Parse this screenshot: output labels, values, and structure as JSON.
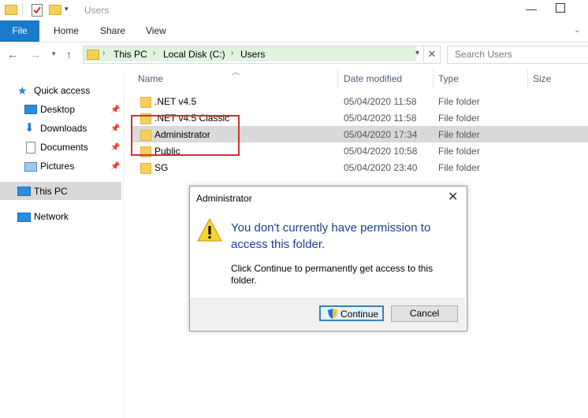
{
  "window": {
    "title": "Users"
  },
  "ribbon": {
    "file": "File",
    "tabs": [
      "Home",
      "Share",
      "View"
    ]
  },
  "address": {
    "crumbs": [
      "This PC",
      "Local Disk (C:)",
      "Users"
    ],
    "search_placeholder": "Search Users"
  },
  "sidebar": {
    "quick_access": "Quick access",
    "pinned": [
      "Desktop",
      "Downloads",
      "Documents",
      "Pictures"
    ],
    "this_pc": "This PC",
    "network": "Network"
  },
  "columns": {
    "name": "Name",
    "date": "Date modified",
    "type": "Type",
    "size": "Size"
  },
  "rows": [
    {
      "name": ".NET v4.5",
      "date": "05/04/2020 11:58",
      "type": "File folder"
    },
    {
      "name": ".NET v4.5 Classic",
      "date": "05/04/2020 11:58",
      "type": "File folder"
    },
    {
      "name": "Administrator",
      "date": "05/04/2020 17:34",
      "type": "File folder"
    },
    {
      "name": "Public",
      "date": "05/04/2020 10:58",
      "type": "File folder"
    },
    {
      "name": "SG",
      "date": "05/04/2020 23:40",
      "type": "File folder"
    }
  ],
  "dialog": {
    "title": "Administrator",
    "heading": "You don't currently have permission to access this folder.",
    "body": "Click Continue to permanently get access to this folder.",
    "continue": "Continue",
    "cancel": "Cancel"
  },
  "colors": {
    "accent": "#1979ca",
    "highlight": "#d23030",
    "heading": "#1a3f8f"
  }
}
